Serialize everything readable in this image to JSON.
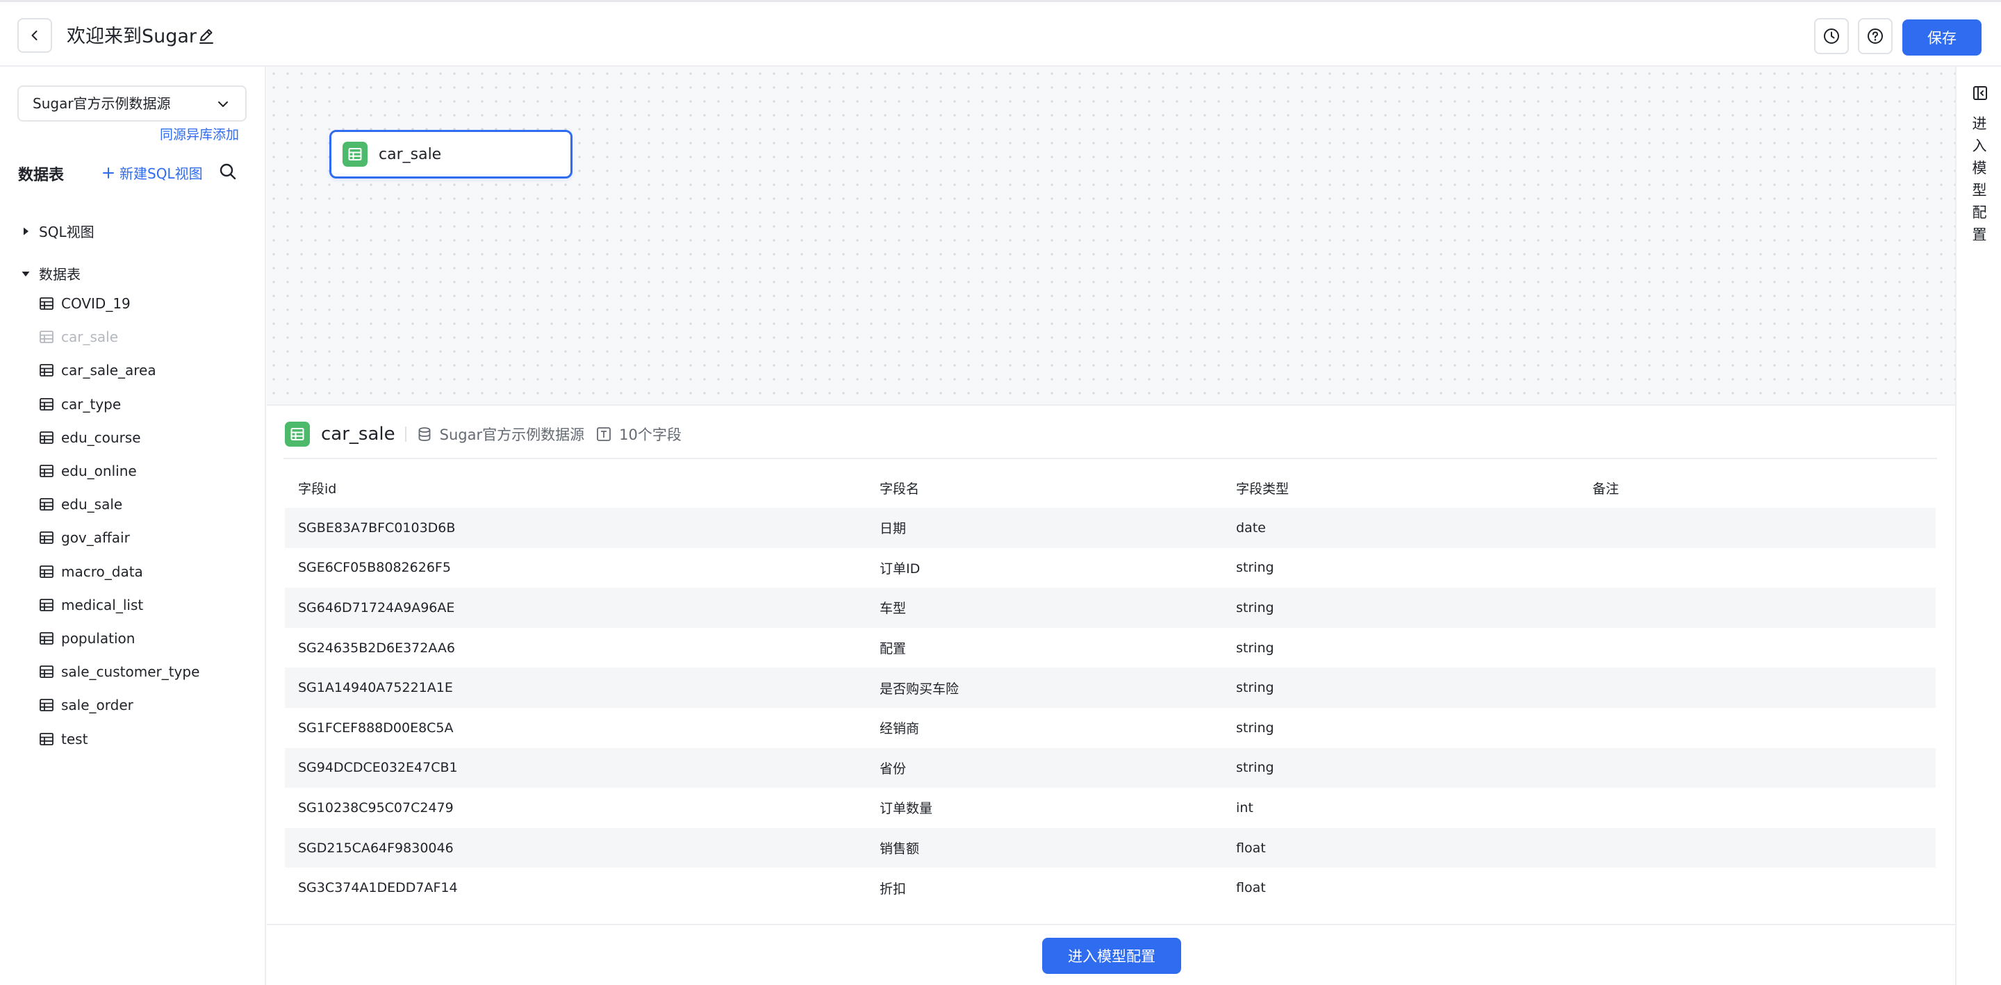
{
  "header": {
    "title": "欢迎来到Sugar",
    "save_label": "保存"
  },
  "sidebar": {
    "datasource_selected": "Sugar官方示例数据源",
    "add_link": "同源异库添加",
    "tables_heading": "数据表",
    "new_sql_label": "新建SQL视图",
    "groups": [
      {
        "label": "SQL视图",
        "expanded": false
      },
      {
        "label": "数据表",
        "expanded": true
      }
    ],
    "tables": [
      {
        "label": "COVID_19",
        "active": true
      },
      {
        "label": "car_sale",
        "active": false
      },
      {
        "label": "car_sale_area",
        "active": true
      },
      {
        "label": "car_type",
        "active": true
      },
      {
        "label": "edu_course",
        "active": true
      },
      {
        "label": "edu_online",
        "active": true
      },
      {
        "label": "edu_sale",
        "active": true
      },
      {
        "label": "gov_affair",
        "active": true
      },
      {
        "label": "macro_data",
        "active": true
      },
      {
        "label": "medical_list",
        "active": true
      },
      {
        "label": "population",
        "active": true
      },
      {
        "label": "sale_customer_type",
        "active": true
      },
      {
        "label": "sale_order",
        "active": true
      },
      {
        "label": "test",
        "active": true
      }
    ]
  },
  "canvas": {
    "node_label": "car_sale"
  },
  "rail": {
    "label": "进入模型配置"
  },
  "detail": {
    "title": "car_sale",
    "datasource": "Sugar官方示例数据源",
    "field_count": "10个字段",
    "columns": [
      "字段id",
      "字段名",
      "字段类型",
      "备注"
    ],
    "rows": [
      {
        "id": "SGBE83A7BFC0103D6B",
        "name": "日期",
        "type": "date",
        "note": ""
      },
      {
        "id": "SGE6CF05B8082626F5",
        "name": "订单ID",
        "type": "string",
        "note": ""
      },
      {
        "id": "SG646D71724A9A96AE",
        "name": "车型",
        "type": "string",
        "note": ""
      },
      {
        "id": "SG24635B2D6E372AA6",
        "name": "配置",
        "type": "string",
        "note": ""
      },
      {
        "id": "SG1A14940A75221A1E",
        "name": "是否购买车险",
        "type": "string",
        "note": ""
      },
      {
        "id": "SG1FCEF888D00E8C5A",
        "name": "经销商",
        "type": "string",
        "note": ""
      },
      {
        "id": "SG94DCDCE032E47CB1",
        "name": "省份",
        "type": "string",
        "note": ""
      },
      {
        "id": "SG10238C95C07C2479",
        "name": "订单数量",
        "type": "int",
        "note": ""
      },
      {
        "id": "SGD215CA64F9830046",
        "name": "销售额",
        "type": "float",
        "note": ""
      },
      {
        "id": "SG3C374A1DEDD7AF14",
        "name": "折扣",
        "type": "float",
        "note": ""
      }
    ]
  },
  "footer": {
    "enter_label": "进入模型配置"
  },
  "colors": {
    "accent": "#2f6cf0",
    "table_icon_green": "#4cba6a"
  }
}
